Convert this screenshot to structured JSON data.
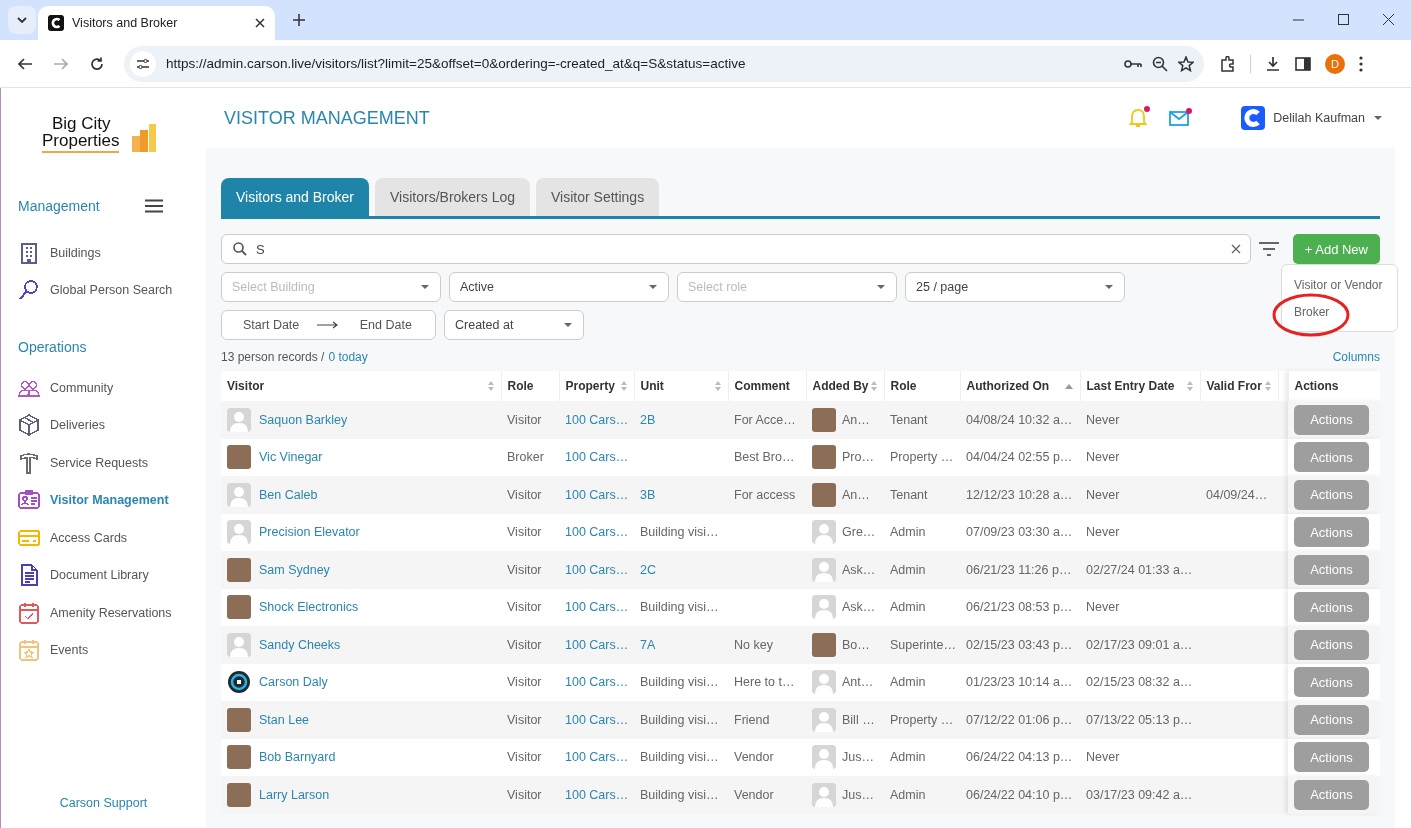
{
  "browser": {
    "tab_title": "Visitors and Broker",
    "url": "https://admin.carson.live/visitors/list?limit=25&offset=0&ordering=-created_at&q=S&status=active",
    "profile_initial": "D"
  },
  "sidebar": {
    "logo_line1": "Big City",
    "logo_line2": "Properties",
    "sections": [
      {
        "title": "Management",
        "items": [
          {
            "label": "Buildings",
            "color": "#5b5f8f",
            "selected": false
          },
          {
            "label": "Global Person Search",
            "color": "#5b3fc0",
            "selected": false
          }
        ]
      },
      {
        "title": "Operations",
        "items": [
          {
            "label": "Community",
            "color": "#b455c8",
            "selected": false
          },
          {
            "label": "Deliveries",
            "color": "#5c6079",
            "selected": false
          },
          {
            "label": "Service Requests",
            "color": "#6b6b6b",
            "selected": false
          },
          {
            "label": "Visitor Management",
            "color": "#a24fc6",
            "selected": true
          },
          {
            "label": "Access Cards",
            "color": "#f5b700",
            "selected": false
          },
          {
            "label": "Document Library",
            "color": "#4b3fb3",
            "selected": false
          },
          {
            "label": "Amenity Reservations",
            "color": "#e05a5a",
            "selected": false
          },
          {
            "label": "Events",
            "color": "#f4c27a",
            "selected": false
          }
        ]
      }
    ],
    "footer": "Carson Support"
  },
  "header": {
    "title": "VISITOR MANAGEMENT",
    "notifications": [
      {
        "kind": "bell",
        "dot": true
      },
      {
        "kind": "mail",
        "dot": true
      }
    ],
    "user": "Delilah Kaufman"
  },
  "tabs": [
    {
      "label": "Visitors and Broker",
      "selected": true
    },
    {
      "label": "Visitors/Brokers Log",
      "selected": false
    },
    {
      "label": "Visitor Settings",
      "selected": false
    }
  ],
  "search": {
    "value": "S"
  },
  "add_button": "+ Add New",
  "add_menu": [
    {
      "label": "Visitor or Vendor",
      "circled": false
    },
    {
      "label": "Broker",
      "circled": true
    }
  ],
  "filters": [
    {
      "placeholder": "Select Building"
    },
    {
      "value": "Active"
    },
    {
      "placeholder": "Select role"
    },
    {
      "value": "25 / page"
    }
  ],
  "date_range": {
    "start_placeholder": "Start Date",
    "end_placeholder": "End Date"
  },
  "sort_select": {
    "value": "Created at"
  },
  "summary": {
    "count": "13 person records /",
    "today": "0 today"
  },
  "columns_link": "Columns",
  "table": {
    "columns": [
      {
        "label": "Visitor",
        "sortable": true,
        "sorted": false
      },
      {
        "label": "Role",
        "sortable": false
      },
      {
        "label": "Property",
        "sortable": true,
        "sorted": false
      },
      {
        "label": "Unit",
        "sortable": true,
        "sorted": false
      },
      {
        "label": "Comment",
        "sortable": false
      },
      {
        "label": "Added By",
        "sortable": true,
        "sorted": false
      },
      {
        "label": "Role",
        "sortable": false
      },
      {
        "label": "Authorized On",
        "sortable": true,
        "sorted": true
      },
      {
        "label": "Last Entry Date",
        "sortable": true,
        "sorted": false
      },
      {
        "label": "Valid Fror",
        "sortable": true,
        "sorted": false
      },
      {},
      {
        "label": "Actions",
        "sortable": false
      }
    ],
    "rows": [
      {
        "visitor": {
          "name": "Saquon Barkley",
          "kind": "default"
        },
        "role": "Visitor",
        "property": "100 Cars…",
        "unit": {
          "text": "2B",
          "link": true
        },
        "comment": "For Acce…",
        "added_by": {
          "name": "An…",
          "kind": "photo"
        },
        "added_by_role": "Tenant",
        "authorized_on": "04/08/24 10:32 a…",
        "last_entry": "Never",
        "action": "Actions"
      },
      {
        "visitor": {
          "name": "Vic Vinegar",
          "kind": "photo"
        },
        "role": "Broker",
        "property": "100 Cars…",
        "comment": "Best Bro…",
        "added_by": {
          "name": "Pro…",
          "kind": "photo"
        },
        "added_by_role": "Property …",
        "authorized_on": "04/04/24 02:55 p…",
        "last_entry": "Never",
        "action": "Actions"
      },
      {
        "visitor": {
          "name": "Ben Caleb",
          "kind": "default"
        },
        "role": "Visitor",
        "property": "100 Cars…",
        "unit": {
          "text": "3B",
          "link": true
        },
        "comment": "For access",
        "added_by": {
          "name": "An…",
          "kind": "photo"
        },
        "added_by_role": "Tenant",
        "authorized_on": "12/12/23 10:28 a…",
        "last_entry": "Never",
        "valid_from": "04/09/24…",
        "action": "Actions"
      },
      {
        "visitor": {
          "name": "Precision Elevator",
          "kind": "default"
        },
        "role": "Visitor",
        "property": "100 Cars…",
        "unit": {
          "text": "Building visi…",
          "link": false
        },
        "added_by": {
          "name": "Gre…",
          "kind": "default"
        },
        "added_by_role": "Admin",
        "authorized_on": "07/09/23 03:30 a…",
        "last_entry": "Never",
        "action": "Actions"
      },
      {
        "visitor": {
          "name": "Sam Sydney",
          "kind": "photo"
        },
        "role": "Visitor",
        "property": "100 Cars…",
        "unit": {
          "text": "2C",
          "link": true
        },
        "added_by": {
          "name": "Ask…",
          "kind": "default"
        },
        "added_by_role": "Admin",
        "authorized_on": "06/21/23 11:26 p…",
        "last_entry": "02/27/24 01:33 a…",
        "action": "Actions"
      },
      {
        "visitor": {
          "name": "Shock Electronics",
          "kind": "photo"
        },
        "role": "Visitor",
        "property": "100 Cars…",
        "unit": {
          "text": "Building visi…",
          "link": false
        },
        "added_by": {
          "name": "Ask…",
          "kind": "default"
        },
        "added_by_role": "Admin",
        "authorized_on": "06/21/23 08:53 p…",
        "last_entry": "Never",
        "action": "Actions"
      },
      {
        "visitor": {
          "name": "Sandy Cheeks",
          "kind": "default"
        },
        "role": "Visitor",
        "property": "100 Cars…",
        "unit": {
          "text": "7A",
          "link": true
        },
        "comment": "No key",
        "added_by": {
          "name": "Bo…",
          "kind": "photo"
        },
        "added_by_role": "Superinte…",
        "authorized_on": "02/15/23 03:43 p…",
        "last_entry": "02/17/23 09:01 a…",
        "action": "Actions"
      },
      {
        "visitor": {
          "name": "Carson Daly",
          "kind": "logo"
        },
        "role": "Visitor",
        "property": "100 Cars…",
        "unit": {
          "text": "Building visi…",
          "link": false
        },
        "comment": "Here to t…",
        "added_by": {
          "name": "Ant…",
          "kind": "default"
        },
        "added_by_role": "Admin",
        "authorized_on": "01/23/23 10:14 a…",
        "last_entry": "02/15/23 08:32 a…",
        "action": "Actions"
      },
      {
        "visitor": {
          "name": "Stan Lee",
          "kind": "photo"
        },
        "role": "Visitor",
        "property": "100 Cars…",
        "unit": {
          "text": "Building visi…",
          "link": false
        },
        "comment": "Friend",
        "added_by": {
          "name": "Bill …",
          "kind": "default"
        },
        "added_by_role": "Property …",
        "authorized_on": "07/12/22 01:06 p…",
        "last_entry": "07/13/22 05:13 p…",
        "action": "Actions"
      },
      {
        "visitor": {
          "name": "Bob Barnyard",
          "kind": "photo"
        },
        "role": "Visitor",
        "property": "100 Cars…",
        "unit": {
          "text": "Building visi…",
          "link": false
        },
        "comment": "Vendor",
        "added_by": {
          "name": "Jus…",
          "kind": "default"
        },
        "added_by_role": "Admin",
        "authorized_on": "06/24/22 04:13 p…",
        "last_entry": "Never",
        "action": "Actions"
      },
      {
        "visitor": {
          "name": "Larry Larson",
          "kind": "photo"
        },
        "role": "Visitor",
        "property": "100 Cars…",
        "unit": {
          "text": "Building visi…",
          "link": false
        },
        "comment": "Vendor",
        "added_by": {
          "name": "Jus…",
          "kind": "default"
        },
        "added_by_role": "Admin",
        "authorized_on": "06/24/22 04:10 p…",
        "last_entry": "03/17/23 09:42 a…",
        "action": "Actions"
      }
    ]
  }
}
